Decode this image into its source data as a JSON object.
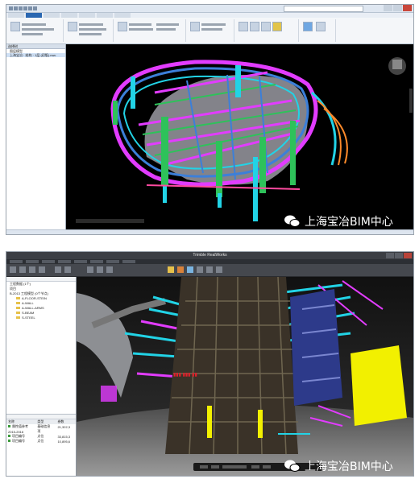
{
  "screenshot1": {
    "app": "Autodesk Navisworks",
    "window_search_placeholder": "",
    "tree": {
      "header": "选择树",
      "items": [
        "图层模型",
        "上海宝冶 · 结构 · 1层 (初版).nwc"
      ]
    }
  },
  "screenshot2": {
    "app_title": "Trimble RealWorks",
    "tree": {
      "items": [
        "工程数据 (1个)",
        "项目",
        "B-2013 工程模型 (0个节点)",
        "A-FLOOR-STEIN",
        "A-WALL",
        "A-WALL-ARMS",
        "S-BEAM",
        "S-STEEL"
      ]
    },
    "properties": {
      "columns": [
        "名称",
        "类型",
        "参数"
      ],
      "rows": [
        [
          "属性值参考",
          "基础信息",
          "21,322,3"
        ],
        [
          "2015-2016",
          "项",
          ""
        ],
        [
          "项目编号",
          "点位",
          "33,815,3"
        ],
        [
          "项目编号",
          "点位",
          "10,895,6"
        ]
      ]
    }
  },
  "watermark": "上海宝冶BIM中心",
  "colors": {
    "magenta": "#e23cff",
    "cyan": "#22d3e6",
    "green": "#2ec25a",
    "steel_blue": "#3c7fd9",
    "orange": "#ff8a2a",
    "yellow": "#f2f000"
  }
}
